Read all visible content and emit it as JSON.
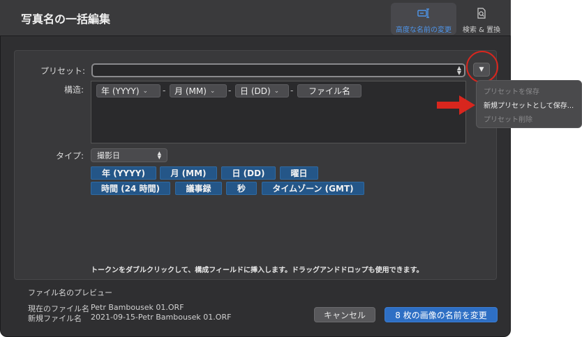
{
  "window": {
    "title": "写真名の一括編集"
  },
  "toolbar": {
    "tabs": [
      {
        "label": "高度な名前の変更",
        "icon": "rename-icon",
        "active": true
      },
      {
        "label": "検索 & 置換",
        "icon": "search-document-icon",
        "active": false
      }
    ]
  },
  "preset": {
    "label": "プリセット:",
    "value": ""
  },
  "structure": {
    "label": "構造:",
    "tokens": [
      "年 (YYYY)",
      "月 (MM)",
      "日 (DD)",
      "ファイル名"
    ],
    "separators": [
      "-",
      "-",
      "-"
    ]
  },
  "type": {
    "label": "タイプ:",
    "selected": "撮影日"
  },
  "available_tokens": {
    "row1": [
      "年 (YYYY)",
      "月 (MM)",
      "日 (DD)",
      "曜日"
    ],
    "row2": [
      "時間 (24 時間)",
      "議事録",
      "秒",
      "タイムゾーン (GMT)"
    ]
  },
  "hint": "トークンをダブルクリックして、構成フィールドに挿入します。ドラッグアンドドロップも使用できます。",
  "preset_menu": {
    "items": [
      {
        "label": "プリセットを保存",
        "enabled": false
      },
      {
        "label": "新規プリセットとして保存...",
        "enabled": true
      },
      {
        "label": "プリセット削除",
        "enabled": false
      }
    ]
  },
  "preview": {
    "title": "ファイル名のプレビュー",
    "current_label": "現在のファイル名",
    "current_value": "Petr Bambousek 01.ORF",
    "new_label": "新規ファイル名",
    "new_value": "2021-09-15-Petr Bambousek 01.ORF"
  },
  "buttons": {
    "cancel": "キャンセル",
    "rename": "8 枚の画像の名前を変更"
  },
  "colors": {
    "accent": "#2e6fc4",
    "token_blue": "#245688",
    "annotation_red": "#d8261e"
  }
}
